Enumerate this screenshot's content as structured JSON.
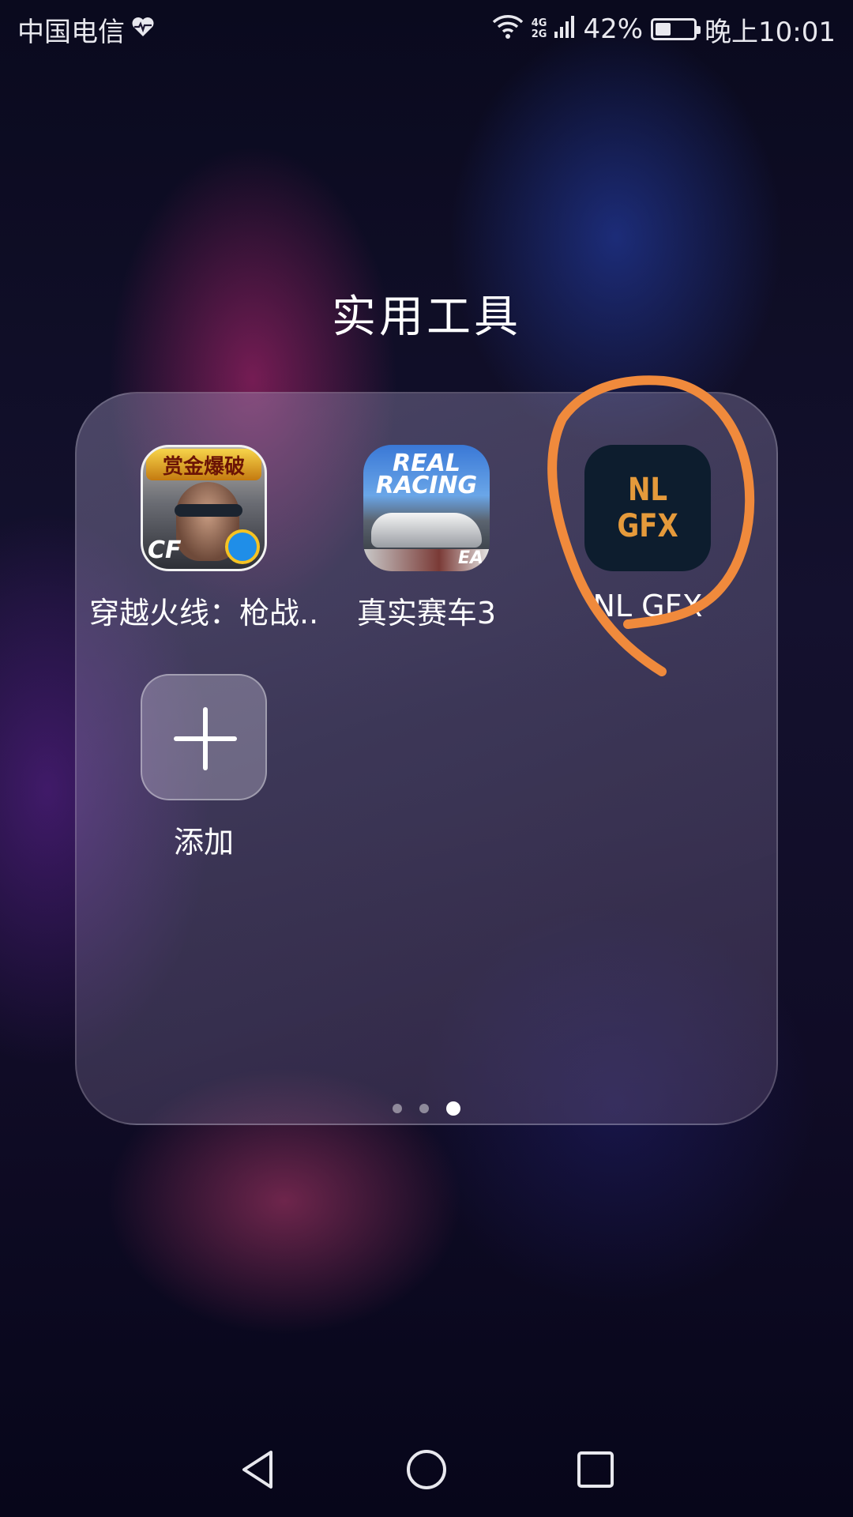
{
  "status_bar": {
    "carrier": "中国电信",
    "network_top": "4G",
    "network_bottom": "2G",
    "battery_percent": "42%",
    "battery_level": 0.42,
    "time": "晚上10:01"
  },
  "folder": {
    "title": "实用工具",
    "apps": [
      {
        "label": "穿越火线：枪战..",
        "icon": "crossfire-game-icon",
        "icon_banner": "赏金爆破",
        "icon_logo": "CF"
      },
      {
        "label": "真实赛车3",
        "icon": "real-racing-3-icon",
        "icon_text": "REAL RACING",
        "icon_badge": "EA"
      },
      {
        "label": "NL GFX",
        "icon": "nl-gfx-icon",
        "icon_text": "NL GFX"
      }
    ],
    "add_tile": {
      "label": "添加",
      "icon": "plus-icon"
    },
    "pages": {
      "count": 3,
      "active": 3
    }
  },
  "annotation": {
    "color": "#f08a3c",
    "target": "NL GFX"
  },
  "nav": {
    "back_icon": "back-triangle-icon",
    "home_icon": "home-circle-icon",
    "recents_icon": "recents-square-icon"
  },
  "colors": {
    "nl_gfx_bg": "#0d1d2e",
    "nl_gfx_text": "#e59a3b",
    "annotation": "#f08a3c"
  }
}
